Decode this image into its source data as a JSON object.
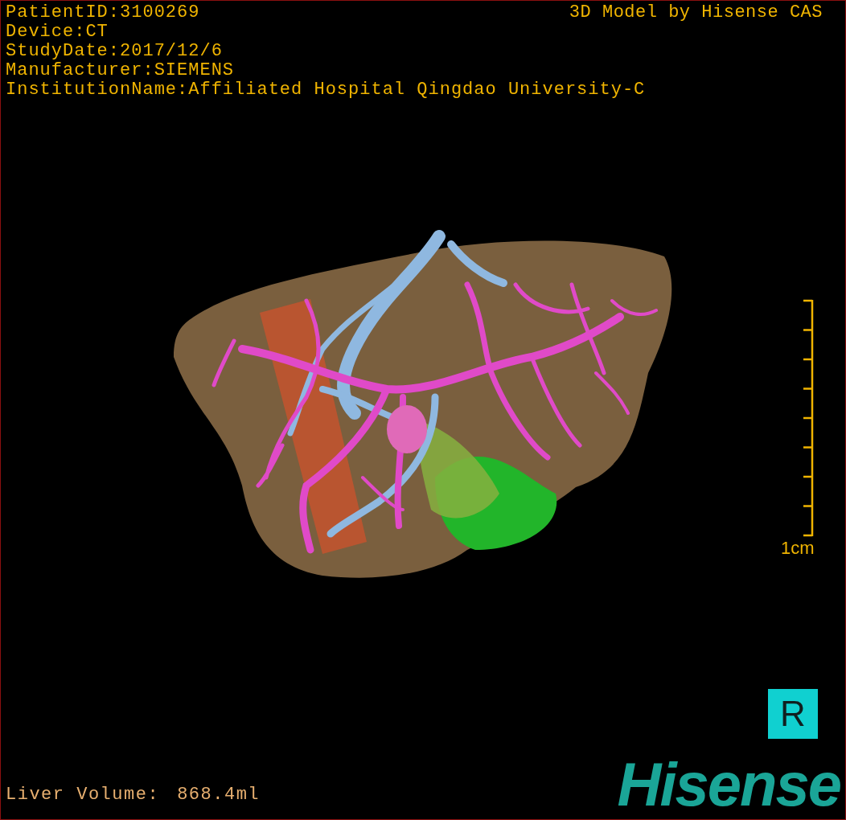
{
  "study_info": [
    "PatientID:3100269",
    "Device:CT",
    "StudyDate:2017/12/6",
    "Manufacturer:SIEMENS",
    "InstitutionName:Affiliated Hospital Qingdao University-C"
  ],
  "model_caption": "3D Model by Hisense CAS",
  "scale_bar": {
    "label": "1cm"
  },
  "orientation_marker": "R",
  "liver_volume": {
    "label": "Liver Volume:",
    "value": "868.4ml"
  },
  "logo": "Hisense"
}
